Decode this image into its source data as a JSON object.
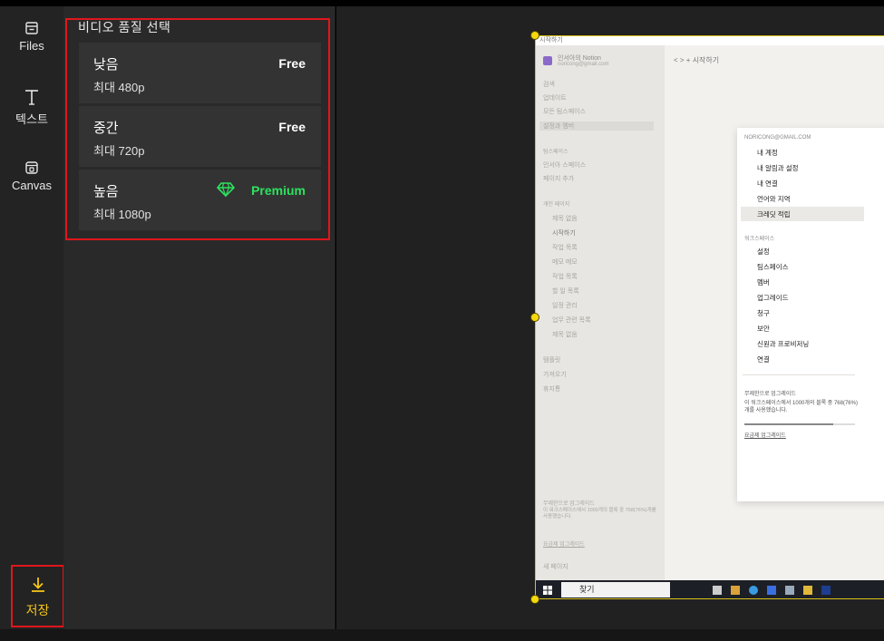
{
  "sidebar": {
    "files": "Files",
    "text": "텍스트",
    "canvas": "Canvas",
    "save": "저장"
  },
  "quality_panel": {
    "title": "비디오 품질 선택",
    "options": [
      {
        "name": "낮음",
        "resolution": "최대 480p",
        "tier": "Free"
      },
      {
        "name": "중간",
        "resolution": "최대 720p",
        "tier": "Free"
      },
      {
        "name": "높음",
        "resolution": "최대 1080p",
        "tier": "Premium"
      }
    ]
  },
  "colors": {
    "accent_yellow": "#f5c518",
    "premium_green": "#2ee25f",
    "highlight_red": "#e0161c"
  },
  "preview": {
    "window_title": "시작하기",
    "workspace_name": "인서아의 Notion",
    "workspace_email": "noricong@gmail.com",
    "breadcrumb": "시작하기",
    "sidebar_items": [
      "검색",
      "업데이트",
      "모든 팀스페이스",
      "설정과 멤버",
      "팀스페이스",
      "인서아 스페이스",
      "페이지 추가",
      "개인 페이지",
      "제목 없음",
      "시작하기",
      "작업 목록",
      "메모 메모",
      "작업 목록",
      "할 일 목록",
      "일정 관리",
      "업무 관련 목록",
      "제목 없음",
      "템플릿",
      "가져오기",
      "휴지통"
    ],
    "sidebar_footer": [
      "무제한으로 업그레이드",
      "이 워크스페이스에서 1000개의 블록 중 768(76%)개를 사용했습니다.",
      "요금제 업그레이드",
      "새 페이지"
    ],
    "settings_menu": {
      "email_header": "NORICONG@GMAIL.COM",
      "account_items": [
        "내 계정",
        "내 알림과 설정",
        "내 연결",
        "언어와 지역",
        "크레딧 적립"
      ],
      "workspace_header": "워크스페이스",
      "workspace_items": [
        "설정",
        "팀스페이스",
        "멤버",
        "업그레이드",
        "청구",
        "보안",
        "신원과 프로비저닝",
        "연결"
      ],
      "upgrade_title": "무제한으로 업그레이드",
      "upgrade_text": "이 워크스페이스에서 1000개의 블록 중 768(76%)개를 사용했습니다.",
      "upgrade_link": "요금제 업그레이드"
    },
    "taskbar_search": "찾기"
  }
}
